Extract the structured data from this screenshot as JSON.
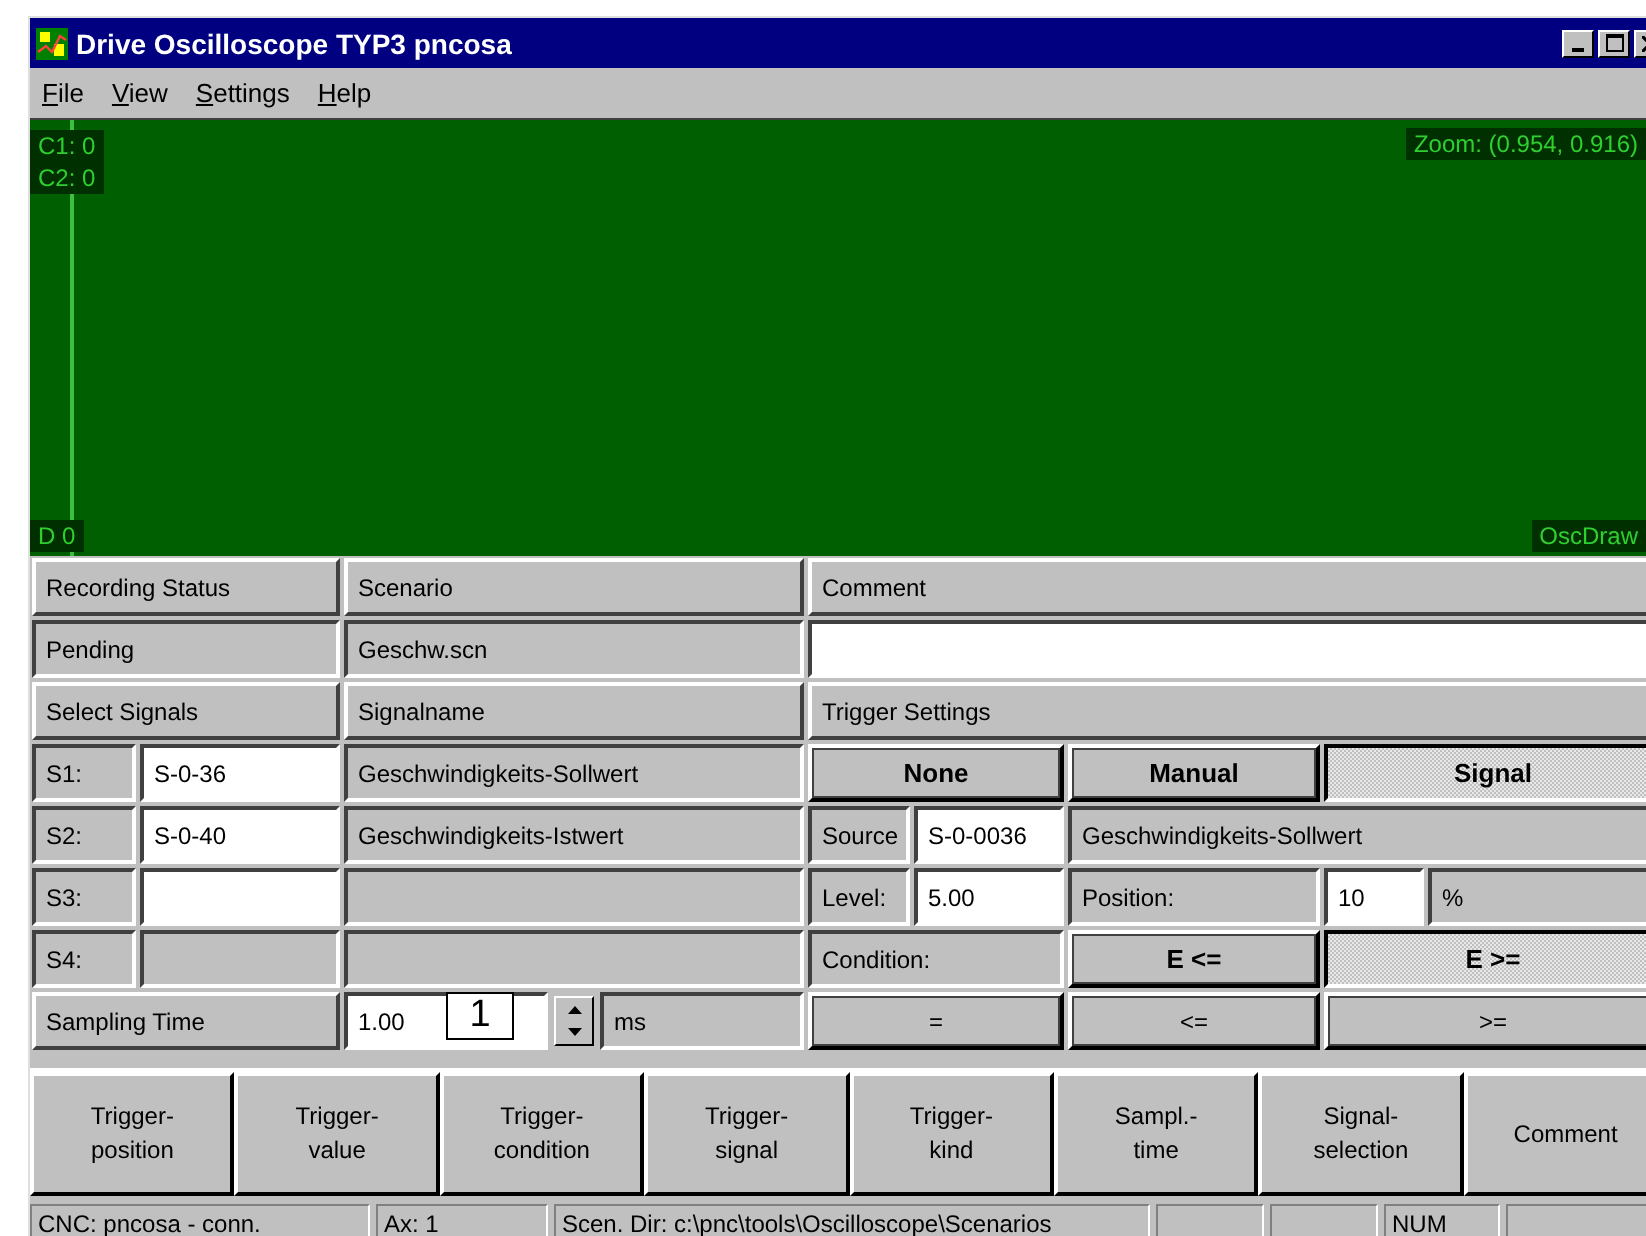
{
  "window": {
    "title": "Drive Oscilloscope TYP3 pncosa"
  },
  "menu": [
    {
      "label": "File"
    },
    {
      "label": "View"
    },
    {
      "label": "Settings"
    },
    {
      "label": "Help"
    }
  ],
  "scope": {
    "channel_labels": [
      "C1: 0",
      "C2: 0"
    ],
    "digital_label": "D 0",
    "zoom": "Zoom: (0.954, 0.916)",
    "name": "OscDraw"
  },
  "headers": {
    "status": "Recording Status",
    "scenario": "Scenario",
    "comment": "Comment",
    "signals": "Select Signals",
    "signalname": "Signalname",
    "trigger": "Trigger Settings"
  },
  "status": "Pending",
  "scenario": "Geschw.scn",
  "signals": [
    {
      "label": "S1:",
      "value": "S-0-36",
      "name": "Geschwindigkeits-Sollwert",
      "disabled": false
    },
    {
      "label": "S2:",
      "value": "S-0-40",
      "name": "Geschwindigkeits-Istwert",
      "disabled": false
    },
    {
      "label": "S3:",
      "disabled": false
    },
    {
      "label": "S4:",
      "disabled": true
    }
  ],
  "trigger_kinds": [
    {
      "label": "None",
      "selected": false
    },
    {
      "label": "Manual",
      "selected": false
    },
    {
      "label": "Signal",
      "selected": true
    }
  ],
  "source": {
    "label": "Source",
    "value": "S-0-0036",
    "name": "Geschwindigkeits-Sollwert"
  },
  "level": {
    "label": "Level:",
    "value": "5.00"
  },
  "position": {
    "label": "Position:",
    "value": "10",
    "unit": "%"
  },
  "condition": {
    "label": "Condition:",
    "options": [
      {
        "label": "E <=",
        "selected": false
      },
      {
        "label": "E >=",
        "selected": true
      }
    ]
  },
  "comparisons": [
    {
      "label": "=",
      "selected": false
    },
    {
      "label": "<=",
      "selected": false
    },
    {
      "label": ">=",
      "selected": false
    }
  ],
  "sampling": {
    "label": "Sampling Time",
    "value": "1.00",
    "unit": "ms",
    "callout": "1"
  },
  "toolbar": [
    "Trigger-\nposition",
    "Trigger-\nvalue",
    "Trigger-\ncondition",
    "Trigger-\nsignal",
    "Trigger-\nkind",
    "Sampl.-\ntime",
    "Signal-\nselection",
    "Comment"
  ],
  "status_bar": {
    "connection": "CNC: pncosa - conn.",
    "axis": "Ax: 1",
    "directory": "Scen. Dir: c:\\pnc\\tools\\Oscilloscope\\Scenarios",
    "num_lock": "NUM"
  }
}
